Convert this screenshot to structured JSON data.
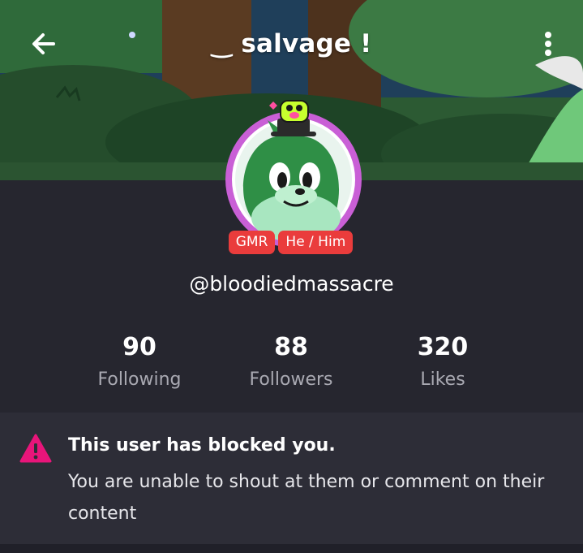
{
  "header": {
    "title": "‿ salvage !",
    "back_icon": "arrow-left-icon",
    "more_icon": "more-vertical-icon"
  },
  "profile": {
    "tags": [
      "GMR",
      "He / Him"
    ],
    "username": "@bloodiedmassacre"
  },
  "stats": [
    {
      "value": "90",
      "label": "Following"
    },
    {
      "value": "88",
      "label": "Followers"
    },
    {
      "value": "320",
      "label": "Likes"
    }
  ],
  "notice": {
    "icon": "warning-icon",
    "title": "This user has blocked you.",
    "body": "You are unable to shout at them or comment on their content"
  },
  "colors": {
    "background": "#26262f",
    "tag": "#ea3c3c",
    "warning": "#e8157a",
    "avatar_ring": "#c95fd6"
  }
}
